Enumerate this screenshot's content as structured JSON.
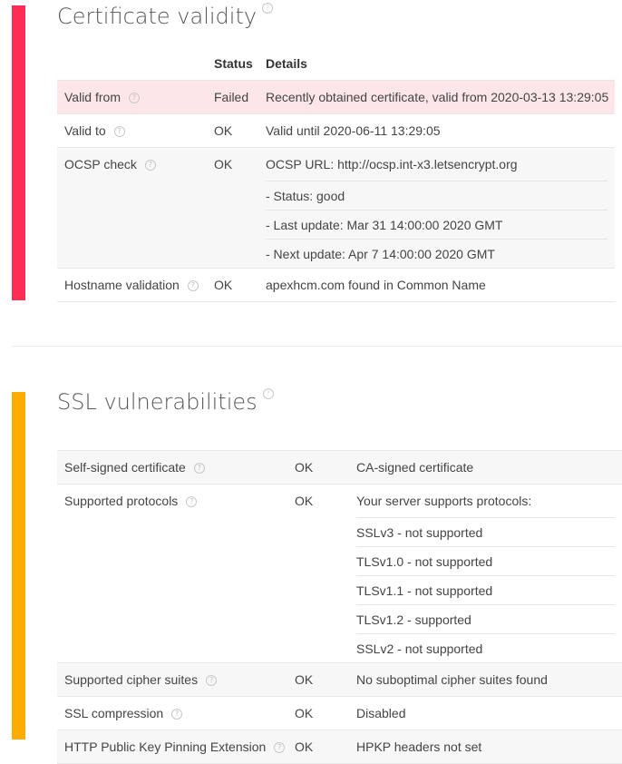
{
  "cert": {
    "title": "Certificate validity",
    "accent": "#ff2d55",
    "columns": {
      "status": "Status",
      "details": "Details"
    },
    "rows": [
      {
        "label": "Valid from",
        "status": "Failed",
        "detail": "Recently obtained certificate, valid from 2020-03-13 13:29:05"
      },
      {
        "label": "Valid to",
        "status": "OK",
        "detail": "Valid until 2020-06-11 13:29:05"
      },
      {
        "label": "OCSP check",
        "status": "OK",
        "detail": "OCSP URL: http://ocsp.int-x3.letsencrypt.org",
        "extra": [
          "- Status: good",
          "- Last update: Mar 31 14:00:00 2020 GMT",
          "- Next update: Apr 7 14:00:00 2020 GMT"
        ]
      },
      {
        "label": "Hostname validation",
        "status": "OK",
        "detail": "apexhcm.com found in Common Name"
      }
    ]
  },
  "ssl": {
    "title": "SSL vulnerabilities",
    "accent": "#ffab00",
    "rows": [
      {
        "label": "Self-signed certificate",
        "status": "OK",
        "detail": "CA-signed certificate"
      },
      {
        "label": "Supported protocols",
        "status": "OK",
        "detail": "Your server supports protocols:",
        "extra": [
          "SSLv3 - not supported",
          "TLSv1.0 - not supported",
          "TLSv1.1 - not supported",
          "TLSv1.2 - supported",
          "SSLv2 - not supported"
        ]
      },
      {
        "label": "Supported cipher suites",
        "status": "OK",
        "detail": "No suboptimal cipher suites found"
      },
      {
        "label": "SSL compression",
        "status": "OK",
        "detail": "Disabled"
      },
      {
        "label": "HTTP Public Key Pinning Extension",
        "status": "OK",
        "detail": "HPKP headers not set"
      }
    ]
  },
  "help_glyph": "?"
}
